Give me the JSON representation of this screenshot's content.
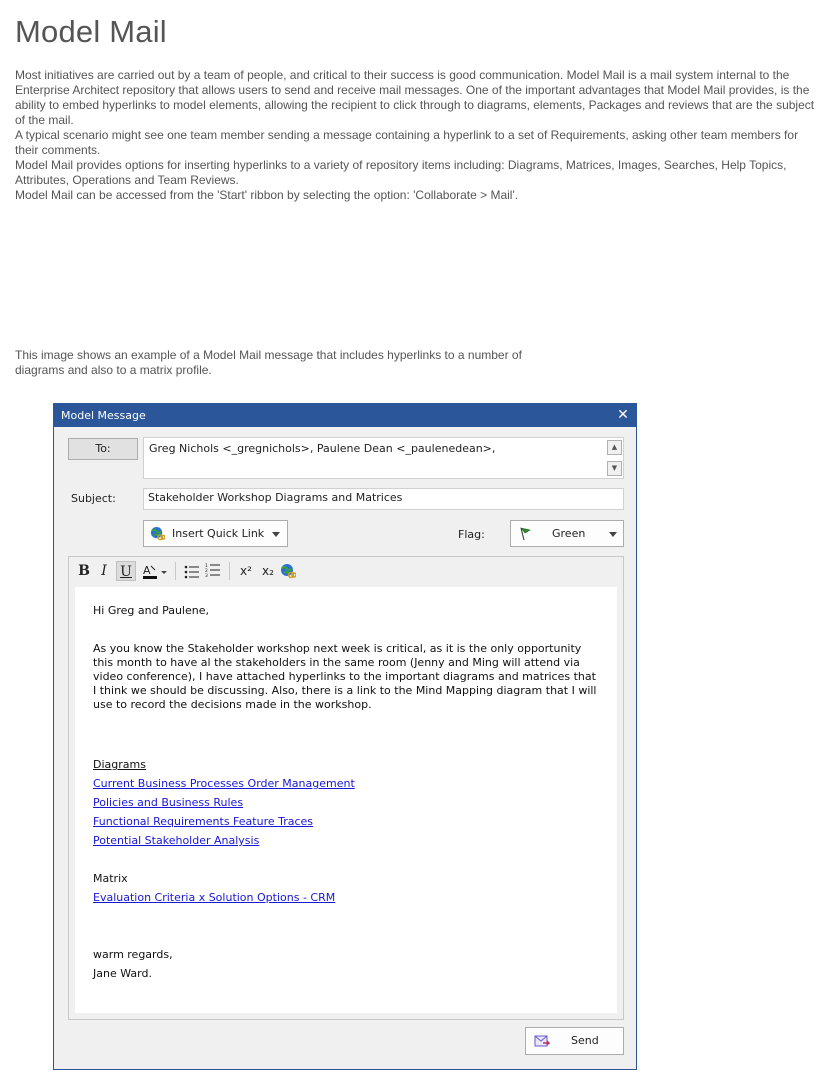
{
  "page": {
    "title": "Model Mail",
    "intro_paragraphs": [
      "Most initiatives are carried out by a team of people, and critical to their success is good communication. Model Mail is a mail system internal to the Enterprise Architect repository that allows users to send and receive mail messages.  One of the important advantages that Model Mail provides, is the ability to embed hyperlinks to model elements, allowing the recipient to click through to diagrams, elements, Packages and reviews that are the subject of the mail.",
      "A typical scenario might see one team member sending a message containing a hyperlink to a set of Requirements, asking other team members for their comments.",
      "Model Mail provides options for inserting hyperlinks to a variety of repository items including: Diagrams, Matrices, Images, Searches, Help Topics, Attributes, Operations and Team Reviews.",
      "Model Mail can be accessed from the 'Start' ribbon by selecting the option:  'Collaborate > Mail'."
    ],
    "caption": "This image shows an example of a Model Mail message that includes hyperlinks to a number of diagrams and also to a matrix profile."
  },
  "dialog": {
    "title": "Model Message",
    "close_glyph": "✕",
    "to_button": "To:",
    "to_value": "Greg Nichols <_gregnichols>, Paulene Dean <_paulenedean>,",
    "subject_label": "Subject:",
    "subject_value": "Stakeholder Workshop Diagrams and Matrices",
    "quick_link_label": "Insert Quick Link",
    "flag_label": "Flag:",
    "flag_value": "Green",
    "flag_color": "#2e8b2e",
    "toolbar": {
      "bold": "B",
      "italic": "I",
      "underline": "U",
      "superscript": "x²",
      "subscript": "x₂"
    },
    "message": {
      "greeting": "Hi Greg and Paulene,",
      "body": "As you know the Stakeholder workshop next week is critical, as it is the only opportunity this month to have al the stakeholders in the same room (Jenny and Ming will attend via video conference), I have attached hyperlinks to the important diagrams and matrices that I think we should be discussing.  Also, there is a link to the Mind Mapping diagram that I will use to record the decisions made in the workshop.",
      "diagrams_heading": "Diagrams",
      "diagram_links": [
        "Current Business Processes Order Management",
        "Policies and Business Rules",
        "Functional Requirements Feature Traces",
        "Potential Stakeholder Analysis"
      ],
      "matrix_heading": "Matrix",
      "matrix_links": [
        "Evaluation Criteria x Solution Options - CRM"
      ],
      "closing": "warm regards,",
      "signature": "Jane Ward."
    },
    "send_label": "Send"
  }
}
